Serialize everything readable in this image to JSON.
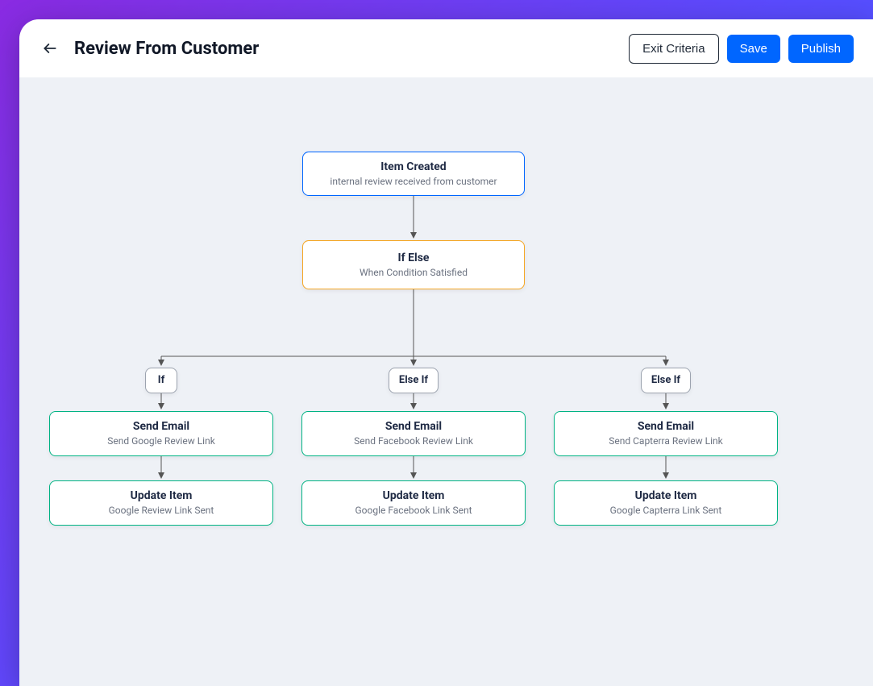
{
  "header": {
    "title": "Review From Customer",
    "exit_criteria_label": "Exit Criteria",
    "save_label": "Save",
    "publish_label": "Publish"
  },
  "flow": {
    "trigger": {
      "title": "Item Created",
      "subtitle": "internal review received from customer"
    },
    "condition": {
      "title": "If Else",
      "subtitle": "When Condition Satisfied"
    },
    "branches": {
      "if_label": "If",
      "elseif1_label": "Else If",
      "elseif2_label": "Else If"
    },
    "col1": {
      "action1_title": "Send Email",
      "action1_sub": "Send Google Review Link",
      "action2_title": "Update Item",
      "action2_sub": "Google Review Link Sent"
    },
    "col2": {
      "action1_title": "Send Email",
      "action1_sub": "Send Facebook Review Link",
      "action2_title": "Update Item",
      "action2_sub": "Google Facebook Link Sent"
    },
    "col3": {
      "action1_title": "Send Email",
      "action1_sub": "Send Capterra Review Link",
      "action2_title": "Update Item",
      "action2_sub": "Google Capterra Link Sent"
    }
  }
}
